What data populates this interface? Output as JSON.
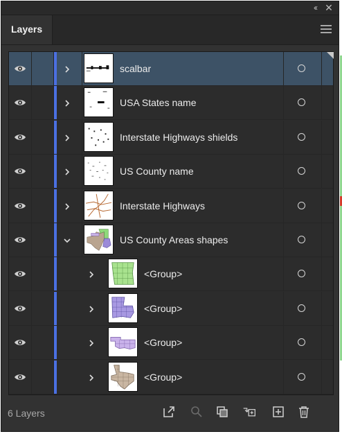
{
  "panel": {
    "tab_label": "Layers",
    "layer_count": "6 Layers",
    "window_controls": [
      "collapse-icon",
      "close-icon"
    ],
    "layer_color": "#4b70e2",
    "selected_row_color": "#3d5266"
  },
  "layers": [
    {
      "name": "scalbar",
      "expanded": false,
      "selected": true,
      "level": 0,
      "thumb": "scalebar"
    },
    {
      "name": "USA States name",
      "expanded": false,
      "selected": false,
      "level": 0,
      "thumb": "states-names"
    },
    {
      "name": "Interstate Highways shields",
      "expanded": false,
      "selected": false,
      "level": 0,
      "thumb": "shields"
    },
    {
      "name": "US County name",
      "expanded": false,
      "selected": false,
      "level": 0,
      "thumb": "county-names"
    },
    {
      "name": "Interstate Highways",
      "expanded": false,
      "selected": false,
      "level": 0,
      "thumb": "highways"
    },
    {
      "name": "US County Areas shapes",
      "expanded": true,
      "selected": false,
      "level": 0,
      "thumb": "county-areas"
    },
    {
      "name": "<Group>",
      "expanded": false,
      "selected": false,
      "level": 1,
      "thumb": "arkansas"
    },
    {
      "name": "<Group>",
      "expanded": false,
      "selected": false,
      "level": 1,
      "thumb": "louisiana"
    },
    {
      "name": "<Group>",
      "expanded": false,
      "selected": false,
      "level": 1,
      "thumb": "oklahoma"
    },
    {
      "name": "<Group>",
      "expanded": false,
      "selected": false,
      "level": 1,
      "thumb": "texas"
    }
  ],
  "footer_icons": [
    "export-icon",
    "search-icon",
    "clipping-mask-icon",
    "move-to-layer-icon",
    "new-layer-icon",
    "trash-icon"
  ]
}
